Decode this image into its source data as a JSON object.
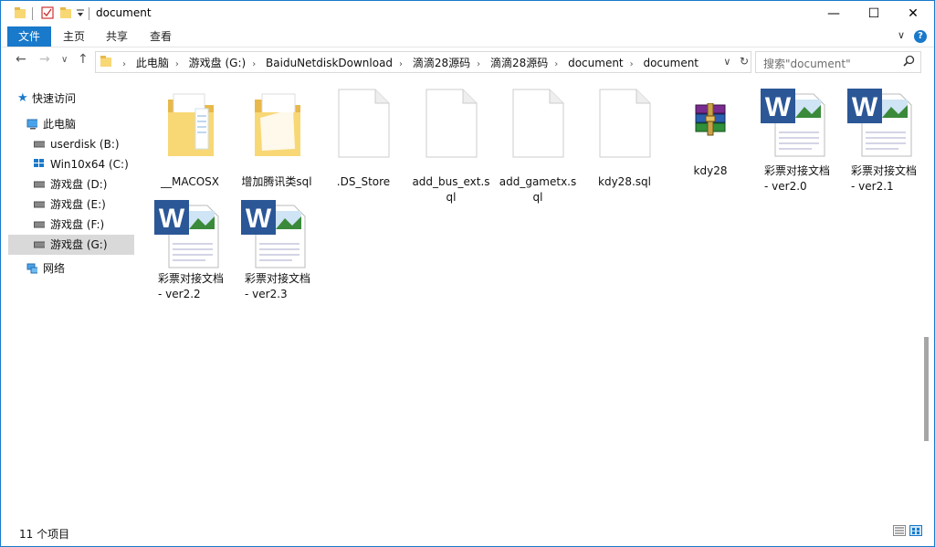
{
  "window": {
    "title": "document"
  },
  "titlebar": {
    "minimize": "—",
    "maximize": "☐",
    "close": "✕"
  },
  "ribbon": {
    "tabs": [
      "文件",
      "主页",
      "共享",
      "查看"
    ],
    "collapse": "∨",
    "help": "?"
  },
  "nav": {
    "back": "←",
    "forward": "→",
    "recent": "∨",
    "up": "↑"
  },
  "address": {
    "crumbs": [
      "此电脑",
      "游戏盘 (G:)",
      "BaiduNetdiskDownload",
      "滴滴28源码",
      "滴滴28源码",
      "document",
      "document"
    ],
    "dropdown": "∨",
    "refresh": "↻"
  },
  "search": {
    "placeholder": "搜索\"document\"",
    "icon": "search-icon"
  },
  "sidebar": {
    "items": [
      {
        "label": "快速访问",
        "icon": "star-icon"
      },
      {
        "label": "此电脑",
        "icon": "computer-icon"
      },
      {
        "label": "userdisk (B:)",
        "icon": "drive-icon"
      },
      {
        "label": "Win10x64 (C:)",
        "icon": "windows-drive-icon"
      },
      {
        "label": "游戏盘 (D:)",
        "icon": "drive-icon"
      },
      {
        "label": "游戏盘 (E:)",
        "icon": "drive-icon"
      },
      {
        "label": "游戏盘 (F:)",
        "icon": "drive-icon"
      },
      {
        "label": "游戏盘 (G:)",
        "icon": "drive-icon",
        "selected": true
      },
      {
        "label": "网络",
        "icon": "network-icon"
      }
    ]
  },
  "files": [
    {
      "name": "__MACOSX",
      "type": "folder"
    },
    {
      "name": "增加腾讯类sql",
      "type": "folder"
    },
    {
      "name": ".DS_Store",
      "type": "file"
    },
    {
      "name": "add_bus_ext.sql",
      "type": "file"
    },
    {
      "name": "add_gametx.sql",
      "type": "file"
    },
    {
      "name": "kdy28.sql",
      "type": "file"
    },
    {
      "name": "kdy28",
      "type": "rar",
      "selected": true
    },
    {
      "name": "彩票对接文档 - ver2.0",
      "type": "word"
    },
    {
      "name": "彩票对接文档 - ver2.1",
      "type": "word"
    },
    {
      "name": "彩票对接文档 - ver2.2",
      "type": "word"
    },
    {
      "name": "彩票对接文档 - ver2.3",
      "type": "word"
    }
  ],
  "status": {
    "count_text": "11 个项目"
  },
  "colors": {
    "accent": "#1979ca",
    "folder": "#f8d775",
    "word": "#2b5797"
  }
}
